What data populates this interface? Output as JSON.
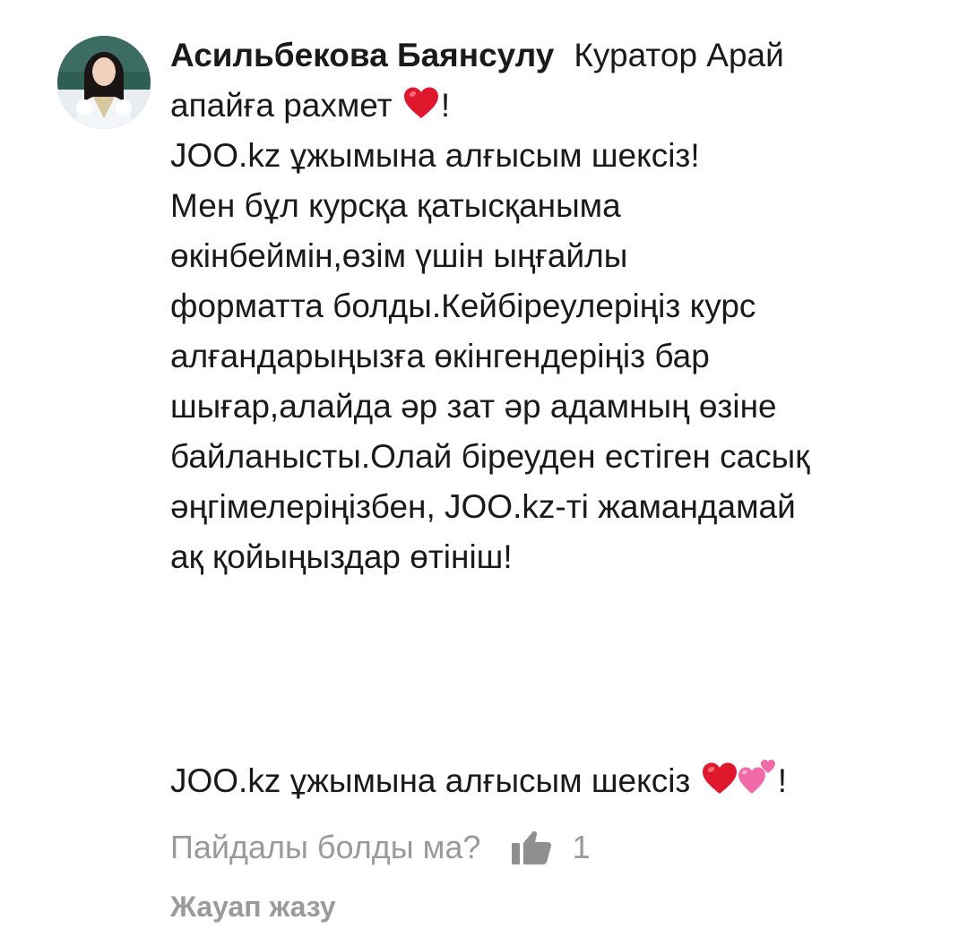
{
  "comment": {
    "author": "Асильбекова Баянсулу",
    "lines": [
      "Куратор Арай",
      "апайға рахмет",
      "!",
      "JOO.kz ұжымына алғысым шексіз!",
      "Мен бұл курсқа қатысқаныма",
      "өкінбеймін,өзім үшін ыңғайлы",
      "форматта болды.Кейбіреулеріңіз курс",
      "алғандарыңызға өкінгендеріңіз  бар",
      "шығар,алайда әр зат әр адамның өзіне",
      "байланысты.Олай біреуден естіген сасық",
      "әңгімелеріңізбен, JOO.kz-ті жамандамай",
      "ақ қойыңыздар өтініш!"
    ],
    "closing_text": "JOO.kz ұжымына алғысым шексіз",
    "closing_end": "!",
    "icons": {
      "heart": "red-heart-icon",
      "two_hearts": "two-hearts-icon",
      "thumb": "thumbs-up-icon"
    }
  },
  "footer": {
    "helpful_question": "Пайдалы болды ма?",
    "like_count": "1",
    "reply_label": "Жауап жазу"
  },
  "colors": {
    "text": "#1a1a1a",
    "muted": "#9a9a9a",
    "heart": "#e0182d",
    "pink_heart": "#f06aa8"
  }
}
